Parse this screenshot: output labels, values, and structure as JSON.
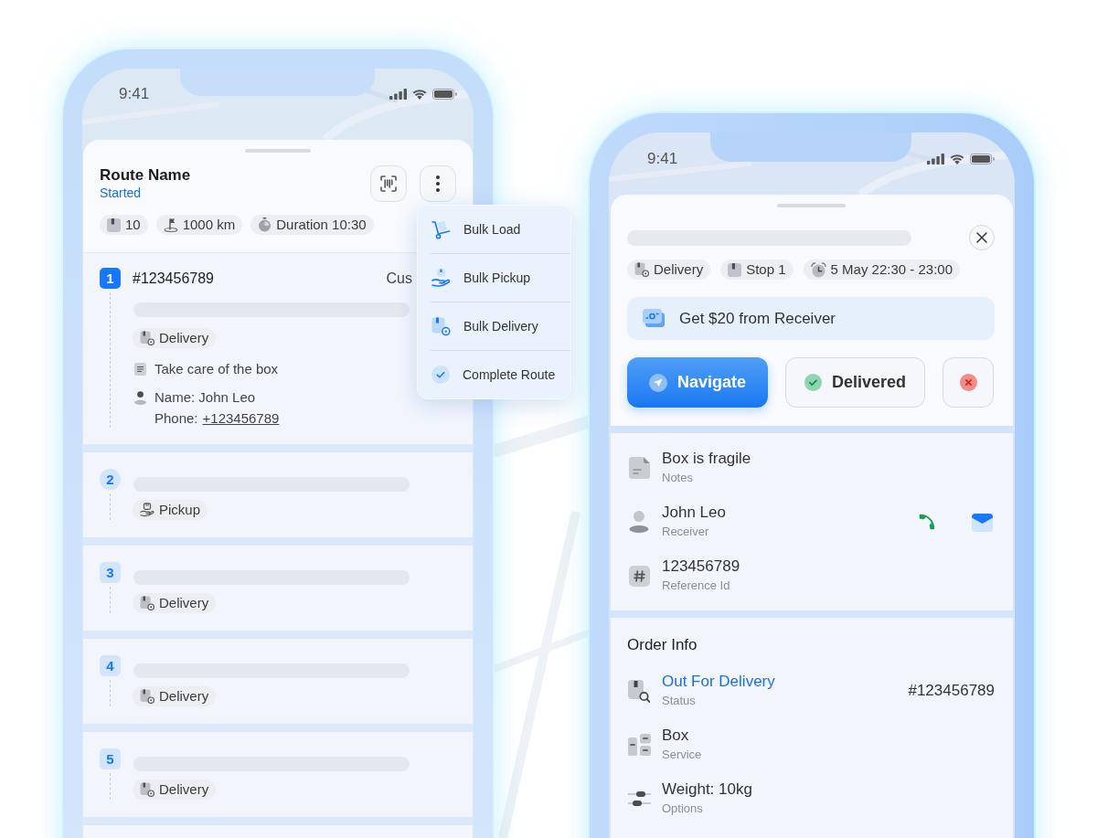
{
  "left_phone": {
    "status_bar": {
      "time": "9:41"
    },
    "route": {
      "title": "Route Name",
      "status": "Started"
    },
    "summary": [
      {
        "kind": "packages",
        "label": "10"
      },
      {
        "kind": "distance",
        "label": "1000 km"
      },
      {
        "kind": "duration",
        "label": "Duration 10:30"
      }
    ],
    "stops": [
      {
        "number": "1",
        "selected": true,
        "kind": "delivery",
        "tag": "Delivery",
        "order_id": "#123456789",
        "trailing_text": "Cus",
        "note": "Take care of the box",
        "contact_name": "Name: John Leo",
        "phone_label": "Phone:",
        "phone": "+123456789"
      },
      {
        "number": "2",
        "selected": false,
        "kind": "pickup",
        "tag": "Pickup"
      },
      {
        "number": "3",
        "selected": false,
        "kind": "delivery",
        "tag": "Delivery"
      },
      {
        "number": "4",
        "selected": false,
        "kind": "delivery",
        "tag": "Delivery"
      },
      {
        "number": "5",
        "selected": false,
        "kind": "delivery",
        "tag": "Delivery"
      }
    ]
  },
  "menu": {
    "items": [
      {
        "kind": "load",
        "label": "Bulk Load"
      },
      {
        "kind": "pickup",
        "label": "Bulk Pickup"
      },
      {
        "kind": "delivery",
        "label": "Bulk Delivery"
      },
      {
        "kind": "complete",
        "label": "Complete Route"
      }
    ]
  },
  "right_phone": {
    "status_bar": {
      "time": "9:41"
    },
    "chips": [
      {
        "kind": "delivery",
        "label": "Delivery"
      },
      {
        "kind": "stop",
        "label": "Stop 1"
      },
      {
        "kind": "time",
        "label": "5 May 22:30 - 23:00"
      }
    ],
    "payment_banner": "Get $20 from Receiver",
    "actions": [
      {
        "kind": "navigate",
        "label": "Navigate"
      },
      {
        "kind": "delivered",
        "label": "Delivered"
      },
      {
        "kind": "cancel"
      }
    ],
    "details": [
      {
        "kind": "notes",
        "value": "Box is fragile",
        "label": "Notes"
      },
      {
        "kind": "receiver",
        "value": "John Leo",
        "label": "Receiver"
      },
      {
        "kind": "reference",
        "value": "123456789",
        "label": "Reference Id"
      }
    ],
    "order_info": {
      "title": "Order Info",
      "rows": [
        {
          "kind": "status",
          "value": "Out For Delivery",
          "label": "Status",
          "trailing": "#123456789"
        },
        {
          "kind": "service",
          "value": "Box",
          "label": "Service"
        },
        {
          "kind": "options",
          "value": "Weight: 10kg",
          "label": "Options"
        }
      ]
    }
  }
}
